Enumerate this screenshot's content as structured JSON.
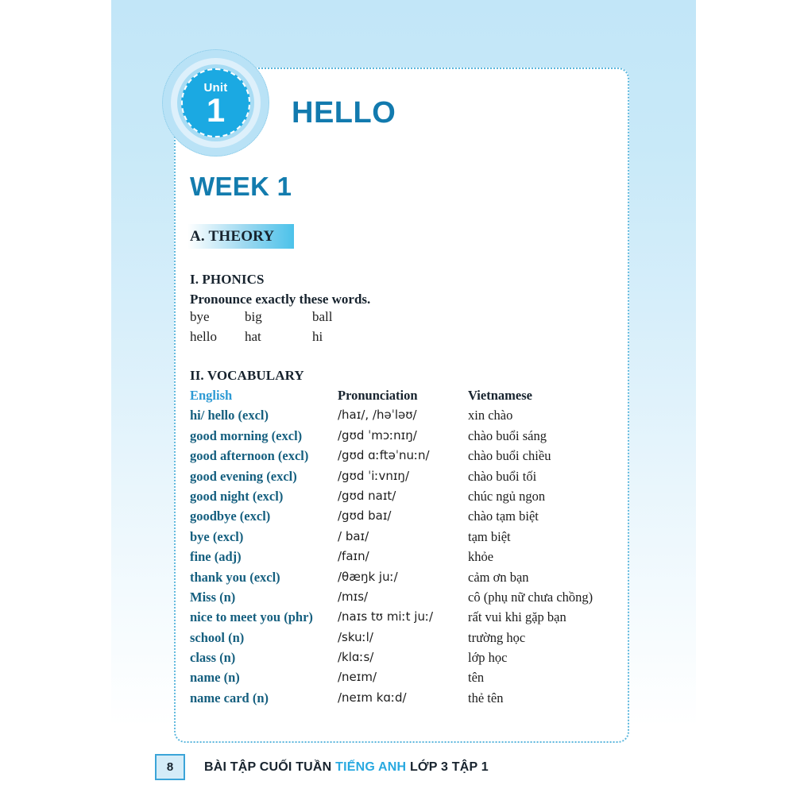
{
  "unit_badge": {
    "word": "Unit",
    "number": "1",
    "accent_color": "#1ba9e2"
  },
  "unit_title": "HELLO",
  "week_title": "WEEK 1",
  "theory_banner": {
    "label": "A. THEORY",
    "accent_color": "#4cc2ea"
  },
  "phonics": {
    "heading": "I. PHONICS",
    "instruction": "Pronounce exactly these words.",
    "rows": [
      [
        "bye",
        "big",
        "ball"
      ],
      [
        "hello",
        "hat",
        "hi"
      ]
    ]
  },
  "vocabulary": {
    "heading": "II. VOCABULARY",
    "columns": [
      "English",
      "Pronunciation",
      "Vietnamese"
    ],
    "entries": [
      {
        "english": "hi/ hello (excl)",
        "pronunciation": "/haɪ/, /həˈləʊ/",
        "vietnamese": "xin chào"
      },
      {
        "english": "good morning (excl)",
        "pronunciation": "/gʊd ˈmɔːnɪŋ/",
        "vietnamese": "chào buổi sáng"
      },
      {
        "english": "good afternoon (excl)",
        "pronunciation": "/gʊd ɑːftəˈnuːn/",
        "vietnamese": "chào buổi chiều"
      },
      {
        "english": "good evening (excl)",
        "pronunciation": "/gʊd ˈiːvnɪŋ/",
        "vietnamese": "chào buổi tối"
      },
      {
        "english": "good night (excl)",
        "pronunciation": "/gʊd naɪt/",
        "vietnamese": "chúc ngủ ngon"
      },
      {
        "english": "goodbye (excl)",
        "pronunciation": "/gʊd baɪ/",
        "vietnamese": "chào tạm biệt"
      },
      {
        "english": "bye (excl)",
        "pronunciation": "/ baɪ/",
        "vietnamese": "tạm biệt"
      },
      {
        "english": "fine (adj)",
        "pronunciation": "/faɪn/",
        "vietnamese": "khỏe"
      },
      {
        "english": "thank you (excl)",
        "pronunciation": "/θæŋk juː/",
        "vietnamese": "cảm ơn bạn"
      },
      {
        "english": "Miss (n)",
        "pronunciation": "/mɪs/",
        "vietnamese": "cô (phụ nữ chưa chồng)"
      },
      {
        "english": "nice to meet you (phr)",
        "pronunciation": "/naɪs tʊ miːt juː/",
        "vietnamese": "rất vui khi gặp bạn"
      },
      {
        "english": "school (n)",
        "pronunciation": "/skuːl/",
        "vietnamese": "trường học"
      },
      {
        "english": "class (n)",
        "pronunciation": "/klɑːs/",
        "vietnamese": "lớp học"
      },
      {
        "english": "name (n)",
        "pronunciation": "/neɪm/",
        "vietnamese": "tên"
      },
      {
        "english": "name card (n)",
        "pronunciation": "/neɪm kɑːd/",
        "vietnamese": "thẻ tên"
      }
    ]
  },
  "footer": {
    "page_number": "8",
    "text_before": "BÀI TẬP CUỐI TUẦN ",
    "text_highlight": "TIẾNG ANH",
    "text_after": " LỚP 3 TẬP 1",
    "highlight_color": "#29a9e0"
  }
}
